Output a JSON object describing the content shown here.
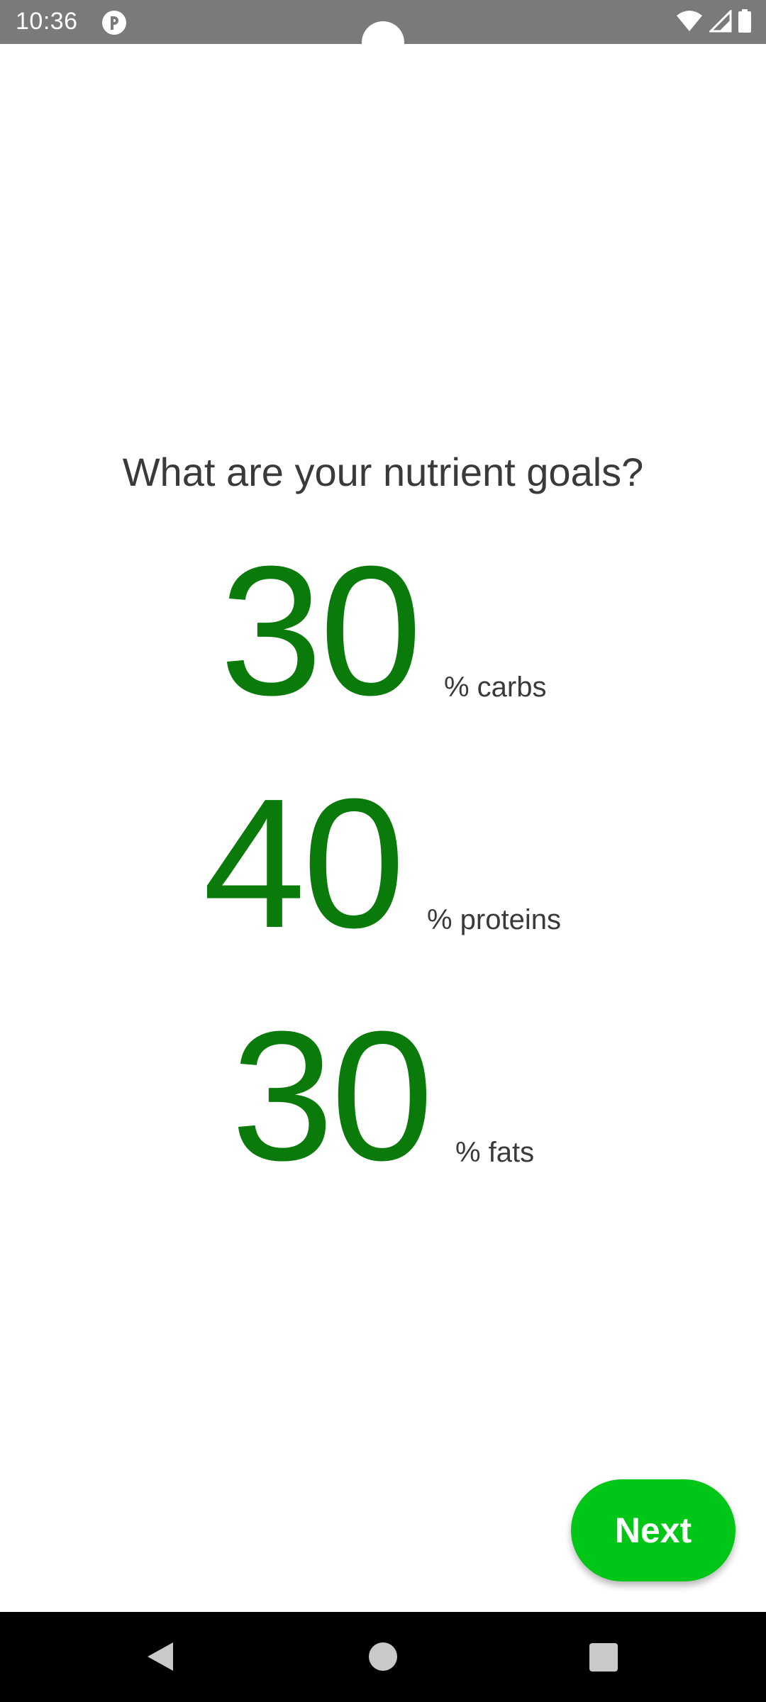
{
  "status_bar": {
    "time": "10:36",
    "app_icon": "p-app-icon",
    "wifi_icon": "wifi-icon",
    "signal_icon": "signal-icon",
    "battery_icon": "battery-icon",
    "background_color": "#7a7a7a"
  },
  "main": {
    "question": "What are your nutrient goals?",
    "goals": [
      {
        "value": "30",
        "unit": "% carbs"
      },
      {
        "value": "40",
        "unit": "% proteins"
      },
      {
        "value": "30",
        "unit": "% fats"
      }
    ],
    "value_color": "#0a7a0a",
    "next_button": "Next",
    "next_button_color": "#00c617"
  },
  "nav_bar": {
    "back_icon": "back-triangle-icon",
    "home_icon": "home-circle-icon",
    "recents_icon": "recents-square-icon"
  }
}
